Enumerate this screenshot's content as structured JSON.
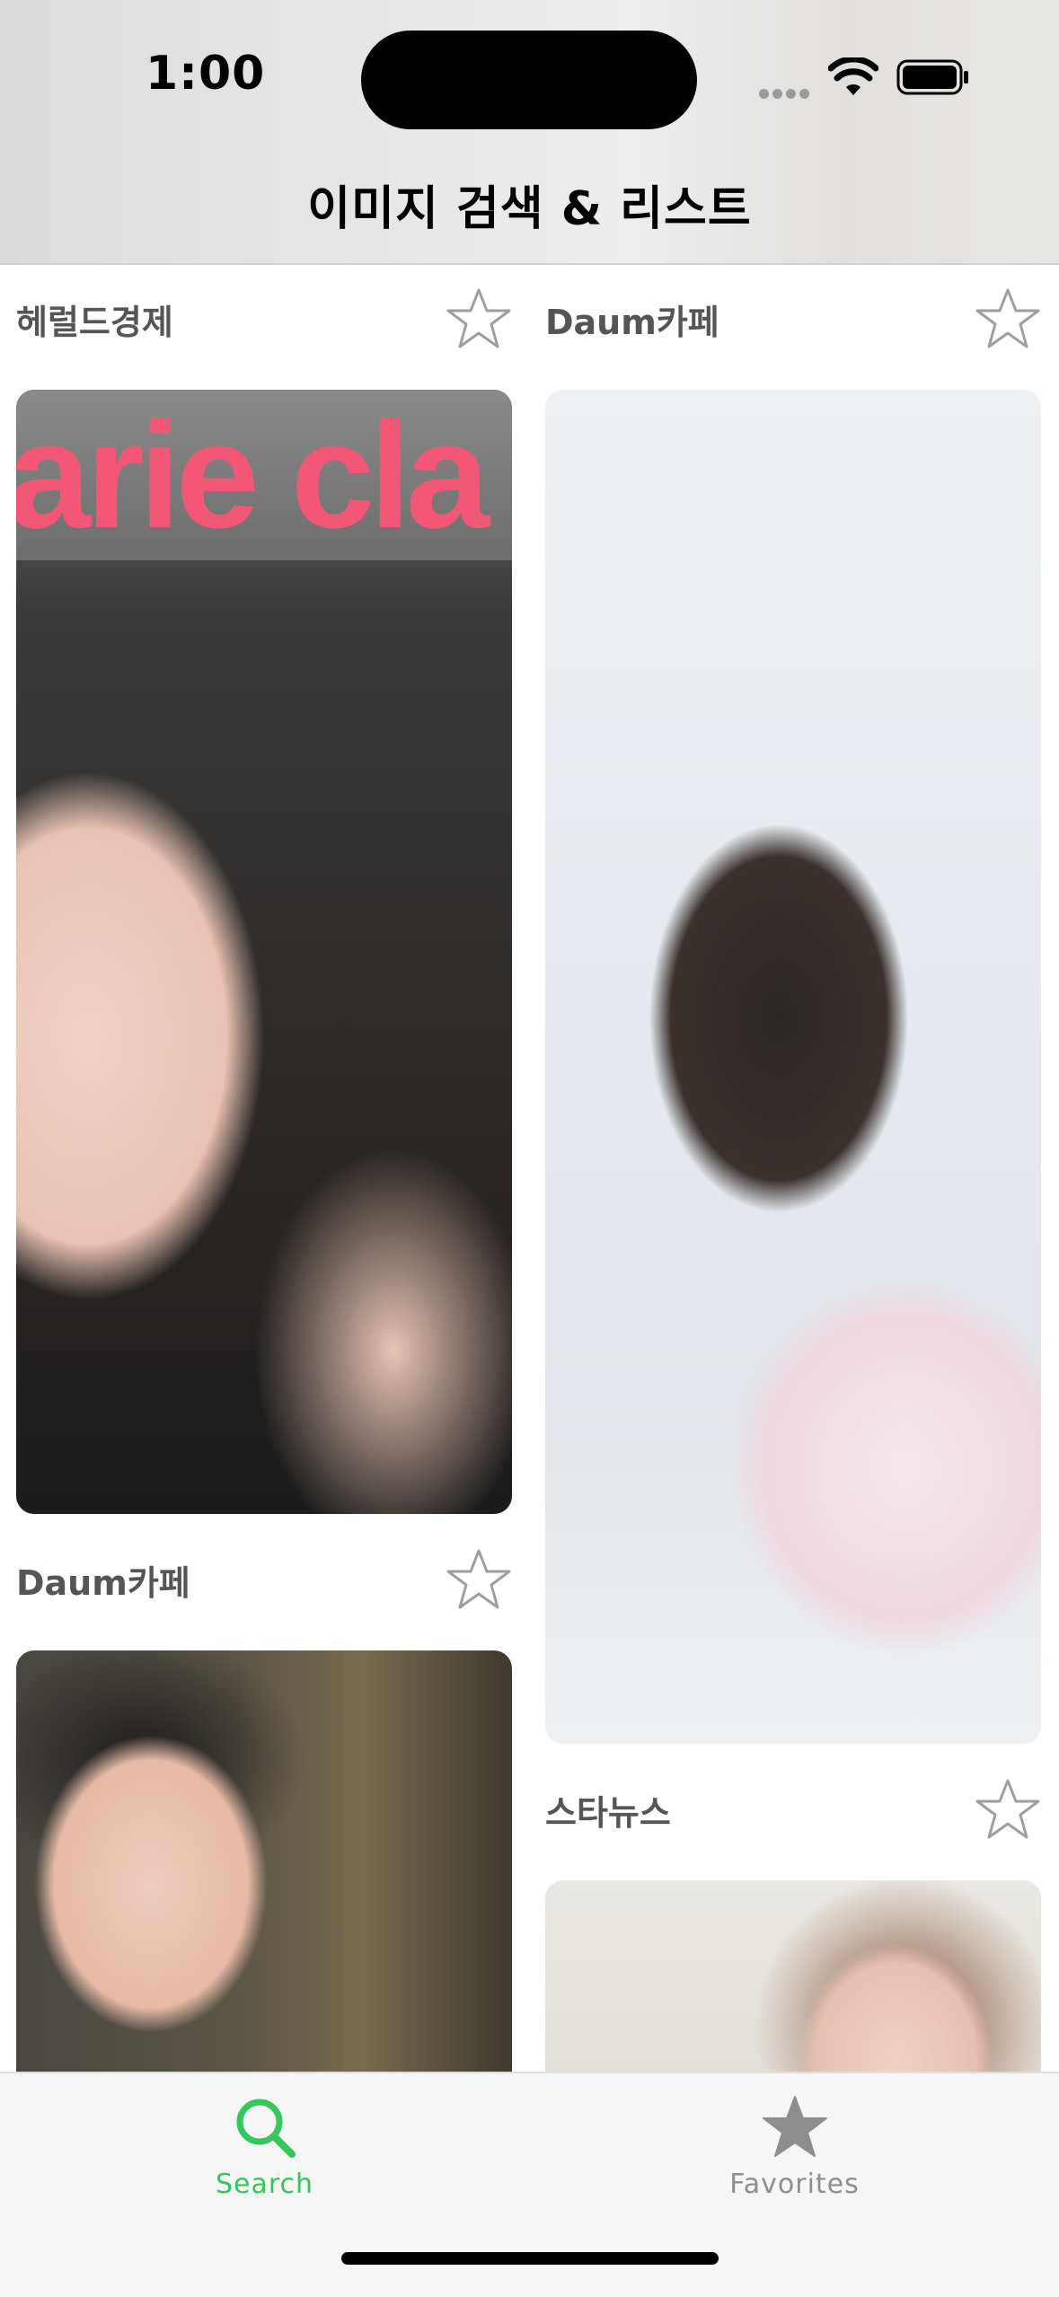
{
  "status_bar": {
    "time": "1:00",
    "icons": [
      "cellular-dots-icon",
      "wifi-icon",
      "battery-icon"
    ]
  },
  "navigation": {
    "title": "이미지 검색 & 리스트"
  },
  "feed": {
    "items": [
      {
        "source": "헤럴드경제",
        "favorited": false,
        "icon": "star-outline-icon"
      },
      {
        "source": "Daum카페",
        "favorited": false,
        "icon": "star-outline-icon"
      },
      {
        "source": "Daum카페",
        "favorited": false,
        "icon": "star-outline-icon"
      },
      {
        "source": "스타뉴스",
        "favorited": false,
        "icon": "star-outline-icon"
      }
    ],
    "image_1_text": "arie cla"
  },
  "tab_bar": {
    "tabs": [
      {
        "label": "Search",
        "icon": "magnifying-glass-icon",
        "selected": true
      },
      {
        "label": "Favorites",
        "icon": "star-filled-icon",
        "selected": false
      }
    ]
  },
  "colors": {
    "accent": "#34c759",
    "inactive": "#8e8e8e",
    "source_text": "#555555",
    "star_outline": "#9e9e9e",
    "magazine_pink": "#f25875"
  }
}
